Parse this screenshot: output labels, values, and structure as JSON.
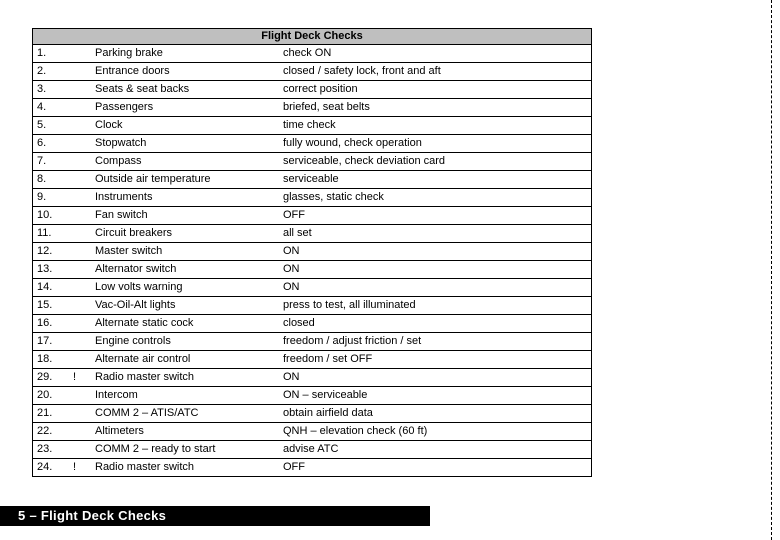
{
  "title": "Flight Deck Checks",
  "footer": "5 – Flight Deck Checks",
  "rows": [
    {
      "n": "1.",
      "mark": "",
      "item": "Parking brake",
      "action": "check ON"
    },
    {
      "n": "2.",
      "mark": "",
      "item": "Entrance doors",
      "action": "closed / safety lock, front and aft"
    },
    {
      "n": "3.",
      "mark": "",
      "item": "Seats & seat backs",
      "action": "correct position"
    },
    {
      "n": "4.",
      "mark": "",
      "item": "Passengers",
      "action": "briefed, seat belts"
    },
    {
      "n": "5.",
      "mark": "",
      "item": "Clock",
      "action": "time check"
    },
    {
      "n": "6.",
      "mark": "",
      "item": "Stopwatch",
      "action": "fully wound, check operation"
    },
    {
      "n": "7.",
      "mark": "",
      "item": "Compass",
      "action": "serviceable, check deviation card"
    },
    {
      "n": "8.",
      "mark": "",
      "item": "Outside air temperature",
      "action": "serviceable"
    },
    {
      "n": "9.",
      "mark": "",
      "item": "Instruments",
      "action": "glasses, static check"
    },
    {
      "n": "10.",
      "mark": "",
      "item": "Fan switch",
      "action": "OFF"
    },
    {
      "n": "11.",
      "mark": "",
      "item": "Circuit breakers",
      "action": "all set"
    },
    {
      "n": "12.",
      "mark": "",
      "item": "Master switch",
      "action": "ON"
    },
    {
      "n": "13.",
      "mark": "",
      "item": "Alternator switch",
      "action": "ON"
    },
    {
      "n": "14.",
      "mark": "",
      "item": "Low volts warning",
      "action": "ON"
    },
    {
      "n": "15.",
      "mark": "",
      "item": "Vac-Oil-Alt lights",
      "action": "press to test, all illuminated"
    },
    {
      "n": "16.",
      "mark": "",
      "item": "Alternate static cock",
      "action": "closed"
    },
    {
      "n": "17.",
      "mark": "",
      "item": "Engine controls",
      "action": "freedom / adjust friction / set"
    },
    {
      "n": "18.",
      "mark": "",
      "item": "Alternate air control",
      "action": "freedom / set OFF"
    },
    {
      "n": "29.",
      "mark": "!",
      "item": "Radio master switch",
      "action": "ON"
    },
    {
      "n": "20.",
      "mark": "",
      "item": "Intercom",
      "action": "ON – serviceable"
    },
    {
      "n": "21.",
      "mark": "",
      "item": "COMM 2 – ATIS/ATC",
      "action": "obtain airfield data"
    },
    {
      "n": "22.",
      "mark": "",
      "item": "Altimeters",
      "action": "QNH – elevation check (60 ft)"
    },
    {
      "n": "23.",
      "mark": "",
      "item": "COMM 2 – ready to start",
      "action": "advise ATC"
    },
    {
      "n": "24.",
      "mark": "!",
      "item": "Radio master switch",
      "action": "OFF"
    }
  ]
}
